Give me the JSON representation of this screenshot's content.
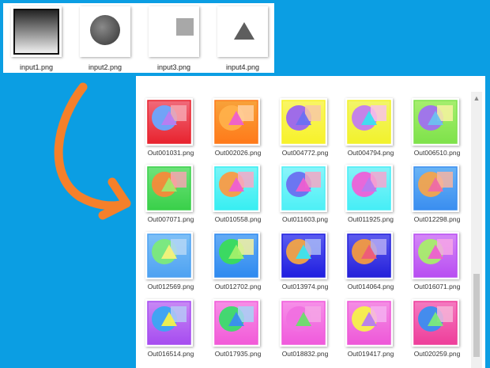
{
  "inputs": [
    {
      "label": "input1.png",
      "icon": "gradient-square-icon"
    },
    {
      "label": "input2.png",
      "icon": "gray-circle-icon"
    },
    {
      "label": "input3.png",
      "icon": "gray-square-icon"
    },
    {
      "label": "input4.png",
      "icon": "gray-triangle-icon"
    }
  ],
  "outputs": [
    {
      "label": "Out001031.png",
      "bg": [
        "#e8232e",
        "#f06a7a"
      ],
      "circle": "#6aa8ff",
      "square": "#f6a6b0",
      "tri": "#ba7cf0"
    },
    {
      "label": "Out002026.png",
      "bg": [
        "#ff7a1a",
        "#f7a23a"
      ],
      "circle": "#ffb04a",
      "square": "#ffd0a0",
      "tri": "#ee5fd0"
    },
    {
      "label": "Out004772.png",
      "bg": [
        "#f7f22a",
        "#f9f566"
      ],
      "circle": "#9a64f0",
      "square": "#f8c8a6",
      "tri": "#6a70f2"
    },
    {
      "label": "Out004794.png",
      "bg": [
        "#f2f22c",
        "#f2f56a"
      ],
      "circle": "#c27cf0",
      "square": "#f8c2e8",
      "tri": "#3be0f0"
    },
    {
      "label": "Out006510.png",
      "bg": [
        "#7ee24a",
        "#a6ee6e"
      ],
      "circle": "#a070f0",
      "square": "#f7f3a0",
      "tri": "#6dc0f0"
    },
    {
      "label": "Out007071.png",
      "bg": [
        "#3ad04a",
        "#6ee27a"
      ],
      "circle": "#f58a3a",
      "square": "#f6a6b2",
      "tri": "#a4e86a"
    },
    {
      "label": "Out010558.png",
      "bg": [
        "#38eef2",
        "#7af4f6"
      ],
      "circle": "#fa9a44",
      "square": "#f7a8c8",
      "tri": "#ee5fd2"
    },
    {
      "label": "Out011603.png",
      "bg": [
        "#4ef0f6",
        "#8af4fa"
      ],
      "circle": "#6a6ff0",
      "square": "#f5a6c4",
      "tri": "#ee5fd0"
    },
    {
      "label": "Out011925.png",
      "bg": [
        "#46eef6",
        "#86f2f8"
      ],
      "circle": "#ee60d8",
      "square": "#f6a6d0",
      "tri": "#b67cf0"
    },
    {
      "label": "Out012298.png",
      "bg": [
        "#3a8ef0",
        "#6ab4f4"
      ],
      "circle": "#f2a44e",
      "square": "#f6b4a2",
      "tri": "#ee6ca6"
    },
    {
      "label": "Out012569.png",
      "bg": [
        "#4ea2f2",
        "#7ec0f6"
      ],
      "circle": "#7cea7a",
      "square": "#b4d6f6",
      "tri": "#f6f27a"
    },
    {
      "label": "Out012702.png",
      "bg": [
        "#2f8af0",
        "#64acf4"
      ],
      "circle": "#3adc5a",
      "square": "#f6f2a0",
      "tri": "#a2f06a"
    },
    {
      "label": "Out013974.png",
      "bg": [
        "#1f1ee0",
        "#5a5cf0"
      ],
      "circle": "#f2a446",
      "square": "#a8b8f6",
      "tri": "#3ae4f0"
    },
    {
      "label": "Out014064.png",
      "bg": [
        "#2420da",
        "#5e5cee"
      ],
      "circle": "#f29a42",
      "square": "#b4aaf4",
      "tri": "#ee5a7a"
    },
    {
      "label": "Out016071.png",
      "bg": [
        "#b84df2",
        "#d488f6"
      ],
      "circle": "#a8ee6a",
      "square": "#f6a6e6",
      "tri": "#ee5fd0"
    },
    {
      "label": "Out016514.png",
      "bg": [
        "#a64cf0",
        "#c888f4"
      ],
      "circle": "#3aa6f2",
      "square": "#b6c8f6",
      "tri": "#f6f24a"
    },
    {
      "label": "Out017935.png",
      "bg": [
        "#f25ad8",
        "#f68ee6"
      ],
      "circle": "#3adc6a",
      "square": "#a6d4f6",
      "tri": "#3a8ef0"
    },
    {
      "label": "Out018832.png",
      "bg": [
        "#f05adc",
        "#f690e8"
      ],
      "circle": "#f070e0",
      "square": "#f4a6e6",
      "tri": "#6ade6a"
    },
    {
      "label": "Out019417.png",
      "bg": [
        "#ee58d8",
        "#f48ee4"
      ],
      "circle": "#f6f24a",
      "square": "#f4b0f0",
      "tri": "#b67cf0"
    },
    {
      "label": "Out020259.png",
      "bg": [
        "#ee3e9a",
        "#f47ac0"
      ],
      "circle": "#3a8ef0",
      "square": "#f6b4d8",
      "tri": "#7cea7a"
    }
  ],
  "colors": {
    "background": "#0b9ee3",
    "arrow": "#f5802a"
  }
}
